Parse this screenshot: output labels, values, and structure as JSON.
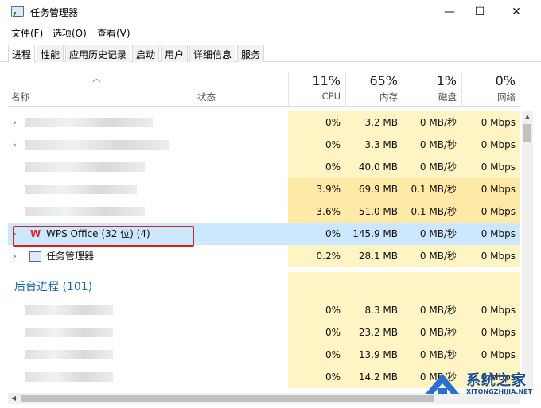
{
  "window": {
    "title": "任务管理器",
    "minimize": "—",
    "maximize": "☐",
    "close": "✕"
  },
  "menu": [
    "文件(F)",
    "选项(O)",
    "查看(V)"
  ],
  "tabs": [
    "进程",
    "性能",
    "应用历史记录",
    "启动",
    "用户",
    "详细信息",
    "服务"
  ],
  "columns": {
    "name": "名称",
    "status": "状态",
    "cpu": {
      "pct": "11%",
      "label": "CPU"
    },
    "memory": {
      "pct": "65%",
      "label": "内存"
    },
    "disk": {
      "pct": "1%",
      "label": "磁盘"
    },
    "network": {
      "pct": "0%",
      "label": "网络"
    }
  },
  "apps": [
    {
      "name": "",
      "cpu": "0%",
      "mem": "3.2 MB",
      "disk": "0 MB/秒",
      "net": "0 Mbps"
    },
    {
      "name": "",
      "cpu": "0%",
      "mem": "3.3 MB",
      "disk": "0 MB/秒",
      "net": "0 Mbps"
    },
    {
      "name": "",
      "cpu": "0%",
      "mem": "40.0 MB",
      "disk": "0 MB/秒",
      "net": "0 Mbps"
    },
    {
      "name": "",
      "cpu": "3.9%",
      "mem": "69.9 MB",
      "disk": "0.1 MB/秒",
      "net": "0 Mbps"
    },
    {
      "name": "",
      "cpu": "3.6%",
      "mem": "51.0 MB",
      "disk": "0.1 MB/秒",
      "net": "0 Mbps"
    },
    {
      "name": "WPS Office (32 位) (4)",
      "cpu": "0%",
      "mem": "145.9 MB",
      "disk": "0 MB/秒",
      "net": "0 Mbps",
      "icon": "wps-icon"
    },
    {
      "name": "任务管理器",
      "cpu": "0.2%",
      "mem": "28.1 MB",
      "disk": "0 MB/秒",
      "net": "0 Mbps",
      "icon": "task-manager-icon"
    }
  ],
  "background_group": {
    "title": "后台进程 (101)"
  },
  "background": [
    {
      "cpu": "0%",
      "mem": "8.3 MB",
      "disk": "0 MB/秒",
      "net": "0 Mbps"
    },
    {
      "cpu": "0%",
      "mem": "23.2 MB",
      "disk": "0 MB/秒",
      "net": "0 Mbps"
    },
    {
      "cpu": "0%",
      "mem": "13.9 MB",
      "disk": "0 MB/秒",
      "net": "0 Mbps"
    },
    {
      "cpu": "0%",
      "mem": "14.2 MB",
      "disk": "0 MB/秒",
      "net": "0 Mbps"
    }
  ],
  "watermark": {
    "title": "系统之家",
    "url": "XITONGZHIJIA.NET"
  },
  "colors": {
    "highlight": "#e01d1d",
    "selected": "#cce8ff",
    "group_title": "#1b63b7"
  }
}
